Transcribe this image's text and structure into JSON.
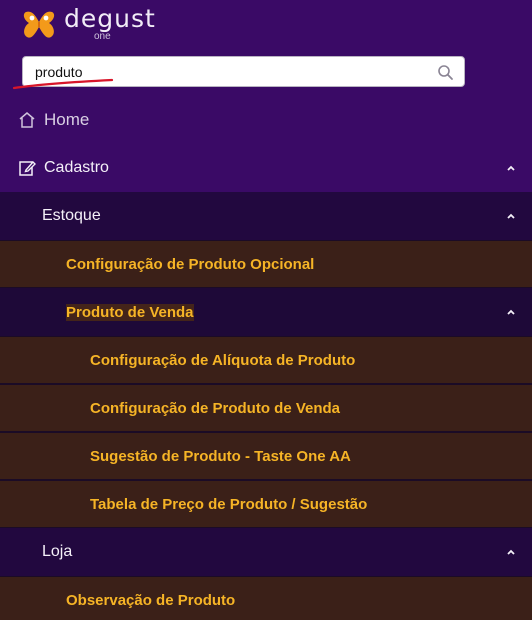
{
  "brand": {
    "name": "degust",
    "sub": "one"
  },
  "search": {
    "value": "produto"
  },
  "menu": {
    "home": "Home",
    "cadastro": "Cadastro",
    "estoque": "Estoque",
    "config_produto_opcional": "Configuração de Produto Opcional",
    "produto_de_venda": "Produto de Venda",
    "config_aliquota": "Configuração de Alíquota de Produto",
    "config_produto_venda": "Configuração de Produto de Venda",
    "sugestao": "Sugestão de Produto - Taste One AA",
    "tabela_preco": "Tabela de Preço de Produto / Sugestão",
    "loja": "Loja",
    "observacao": "Observação de Produto"
  },
  "colors": {
    "header_bg": "#3a0a66",
    "accent_gold": "#f6b426",
    "leaf_bg": "#3b2018",
    "annotation_red": "#d8162a"
  }
}
